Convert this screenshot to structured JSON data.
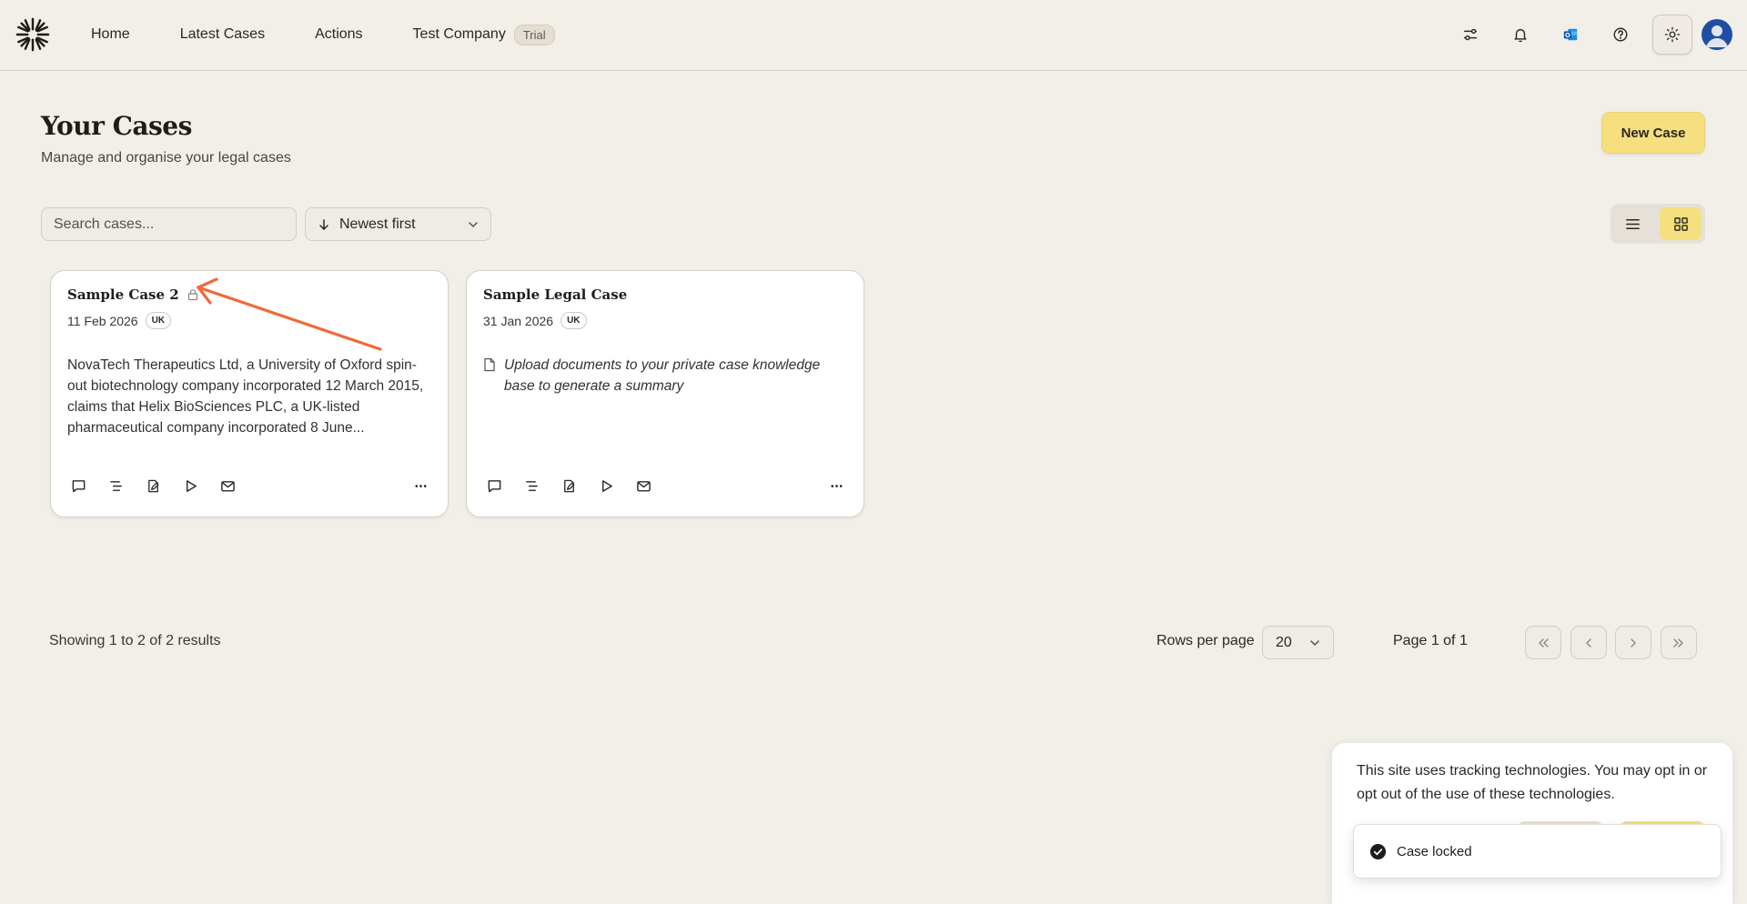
{
  "header": {
    "nav": [
      {
        "label": "Home"
      },
      {
        "label": "Latest Cases"
      },
      {
        "label": "Actions"
      }
    ],
    "company": {
      "name": "Test Company",
      "badge": "Trial"
    },
    "icons": [
      "logo-icon",
      "filters-icon",
      "bell-icon",
      "outlook-icon",
      "help-icon",
      "sun-icon",
      "avatar"
    ]
  },
  "page": {
    "title": "Your Cases",
    "subtitle": "Manage and organise your legal cases",
    "new_case_label": "New Case"
  },
  "controls": {
    "search_placeholder": "Search cases...",
    "sort_label": "Newest first",
    "view_mode": "grid"
  },
  "cases": [
    {
      "title": "Sample Case 2",
      "locked": true,
      "date": "11 Feb 2026",
      "jurisdiction": "UK",
      "summary": "NovaTech Therapeutics Ltd, a University of Oxford spin-out biotechnology company incorporated 12 March 2015, claims that Helix BioSciences PLC, a UK-listed pharmaceutical company incorporated 8 June..."
    },
    {
      "title": "Sample Legal Case",
      "locked": false,
      "date": "31 Jan 2026",
      "jurisdiction": "UK",
      "summary": "Upload documents to your private case knowledge base to generate a summary"
    }
  ],
  "card_actions": [
    "chat-icon",
    "outline-icon",
    "draft-icon",
    "play-icon",
    "email-icon",
    "more-icon"
  ],
  "pagination": {
    "results_text": "Showing 1 to 2 of 2 results",
    "rows_per_page_label": "Rows per page",
    "rows_per_page_value": "20",
    "page_indicator": "Page 1 of 1"
  },
  "cookie_banner": {
    "text": "This site uses tracking technologies. You may opt in or opt out of the use of these technologies."
  },
  "toast": {
    "message": "Case locked"
  },
  "colors": {
    "background": "#f2efe9",
    "accent": "#f6df7e",
    "annotation_arrow": "#f0693a",
    "avatar": "#1f4fa3"
  }
}
